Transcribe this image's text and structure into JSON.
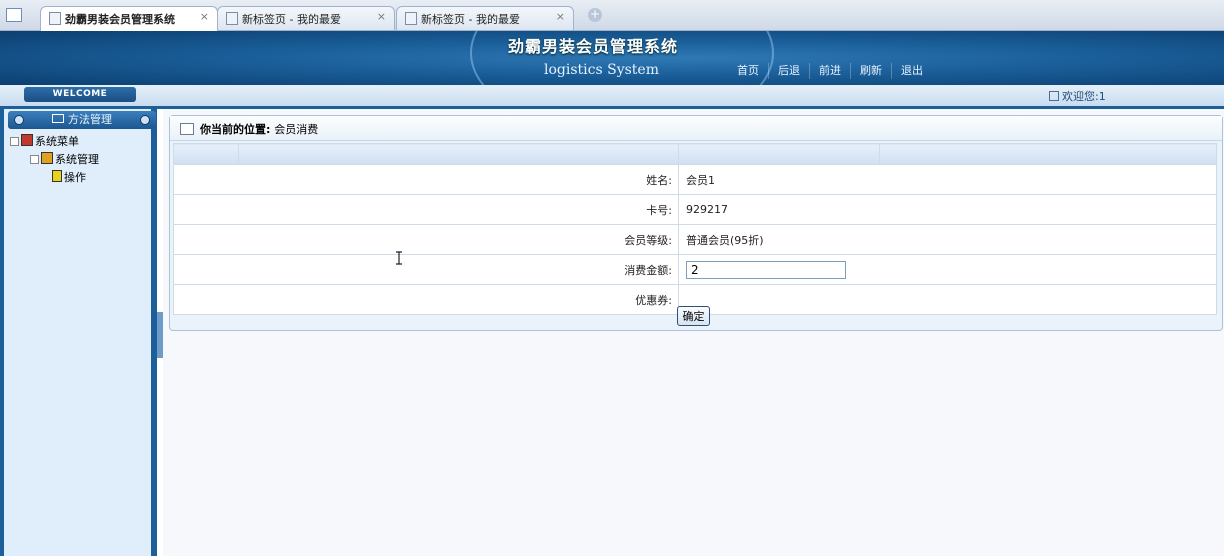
{
  "browser": {
    "tabs": [
      {
        "label": "劲霸男装会员管理系统",
        "close": "×",
        "active": true
      },
      {
        "label": "新标签页 - 我的最爱",
        "close": "×",
        "active": false
      },
      {
        "label": "新标签页 - 我的最爱",
        "close": "×",
        "active": false
      }
    ],
    "new_tab": "+"
  },
  "header": {
    "title": "劲霸男装会员管理系统",
    "subtitle": "logistics System",
    "nav": [
      "首页",
      "后退",
      "前进",
      "刷新",
      "退出"
    ]
  },
  "strip": {
    "welcome": "WELCOME",
    "greeting": "欢迎您:1"
  },
  "sidebar": {
    "header": "方法管理",
    "tree": {
      "root": "系统菜单",
      "child": "系统管理",
      "leaf": "操作"
    }
  },
  "main": {
    "breadcrumb_label": "你当前的位置:",
    "breadcrumb_value": "会员消费",
    "form": {
      "name_label": "姓名:",
      "name_value": "会员1",
      "card_label": "卡号:",
      "card_value": "929217",
      "level_label": "会员等级:",
      "level_value": "普通会员(95折)",
      "amount_label": "消费金额:",
      "amount_value": "2",
      "coupon_label": "优惠券:",
      "coupon_value": ""
    },
    "confirm_label": "确定"
  },
  "colors": {
    "banner": "#1a5e99",
    "sidebar_border": "#1d5f99",
    "sidebar_bg": "#dfeefa"
  }
}
